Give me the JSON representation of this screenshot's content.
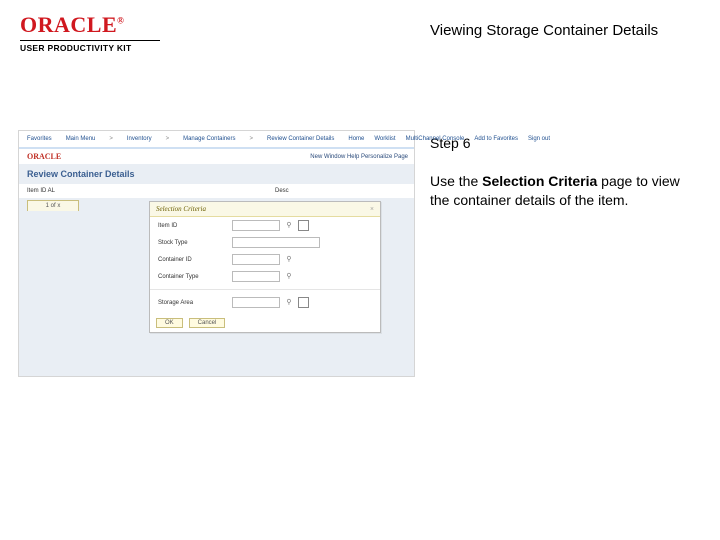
{
  "header": {
    "brand": "ORACLE",
    "brand_suffix": "®",
    "subline": "USER PRODUCTIVITY KIT",
    "doc_title": "Viewing Storage Container Details"
  },
  "instruction": {
    "step_label": "Step 6",
    "text_prefix": "Use the ",
    "text_bold": "Selection Criteria",
    "text_suffix": " page to view the container details of the item."
  },
  "screenshot": {
    "topnav": {
      "items": [
        "Favorites",
        "Main Menu",
        "Inventory",
        "Manage Containers",
        "Review Container Details"
      ],
      "home": "Home",
      "right_items": [
        "Worklist",
        "MultiChannel Console",
        "Add to Favorites",
        "Sign out"
      ]
    },
    "brandbar": {
      "brand": "ORACLE",
      "status": "New Window   Help   Personalize Page"
    },
    "page_title": "Review Container Details",
    "info_row": {
      "left": "Item ID  AL",
      "right": "Desc"
    },
    "tab": "1 of x",
    "panel": {
      "title": "Selection Criteria",
      "close": "×",
      "fields": {
        "item_id": "Item ID",
        "stock_type": "Stock Type",
        "container_id": "Container ID",
        "container_type": "Container Type",
        "storage_area": "Storage Area"
      },
      "buttons": {
        "ok": "OK",
        "cancel": "Cancel"
      }
    }
  }
}
